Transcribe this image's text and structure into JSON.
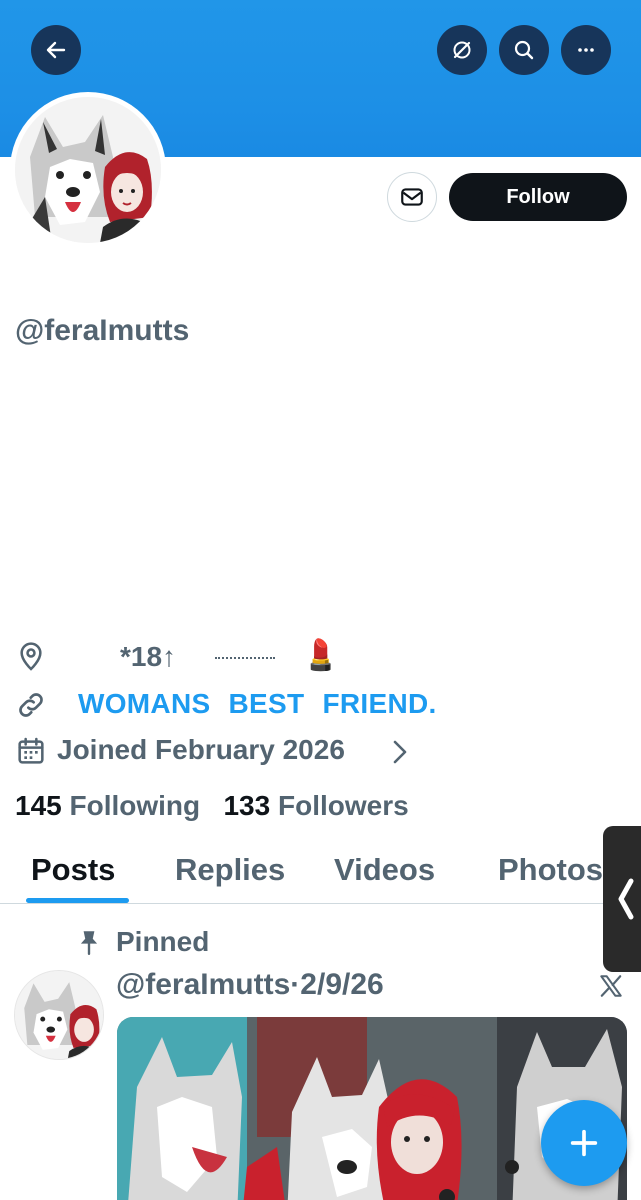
{
  "header": {
    "back_icon": "arrow-left-icon",
    "grok_icon": "grok-icon",
    "search_icon": "search-icon",
    "more_icon": "more-icon",
    "banner_color": "#1d8fe6"
  },
  "profile": {
    "handle": "@feraImutts",
    "follow_label": "Follow",
    "message_icon": "envelope-icon",
    "location": "*18↑",
    "location_emoji": "💄",
    "link": "WOMANS  BEST  FRIEND.",
    "joined": "Joined February 2026",
    "following_count": "145",
    "following_label": "Following",
    "followers_count": "133",
    "followers_label": "Followers"
  },
  "tabs": [
    {
      "label": "Posts",
      "active": true
    },
    {
      "label": "Replies",
      "active": false
    },
    {
      "label": "Videos",
      "active": false
    },
    {
      "label": "Photos",
      "active": false
    }
  ],
  "post": {
    "pinned_label": "Pinned",
    "handle": "@feraImutts",
    "separator": "·",
    "date": "2/9/26"
  },
  "fab": {
    "icon": "plus-icon"
  },
  "colors": {
    "accent": "#1d9bf0",
    "text_secondary": "#536471",
    "text_primary": "#0f1419"
  }
}
